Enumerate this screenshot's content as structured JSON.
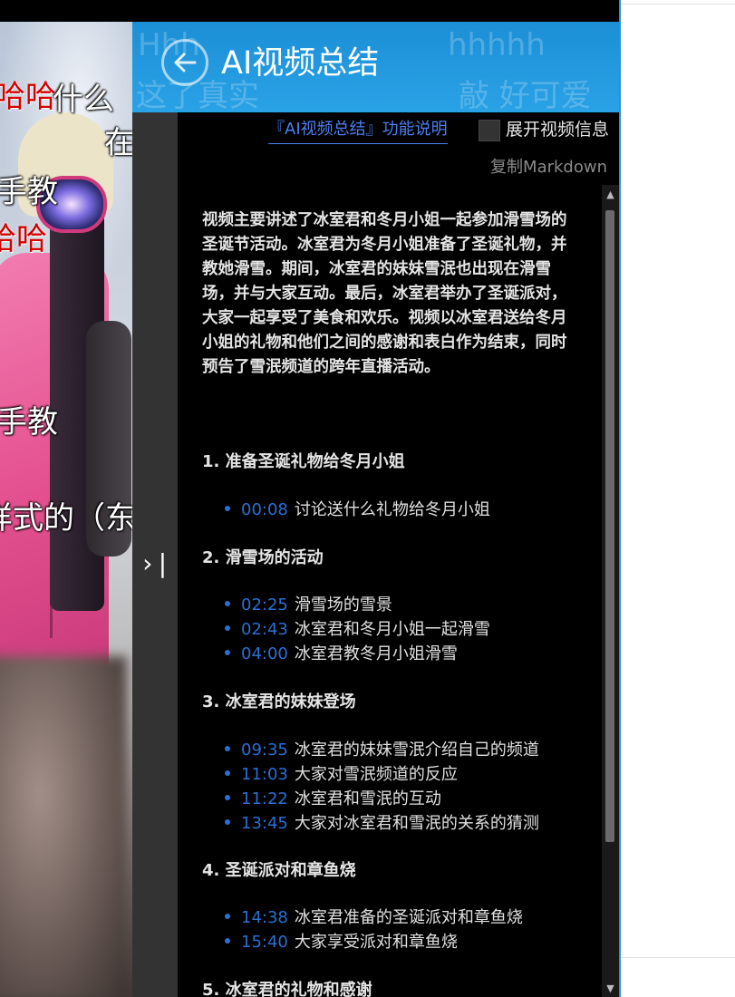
{
  "video": {
    "danmaku": [
      {
        "text": "哈哈",
        "color": "red"
      },
      {
        "text": "什么",
        "color": "white"
      },
      {
        "text": "在",
        "color": "white"
      },
      {
        "text": "手教",
        "color": "white"
      },
      {
        "text": "哈哈",
        "color": "red"
      },
      {
        "text": "手教",
        "color": "white"
      },
      {
        "text": "样式的（东",
        "color": "white"
      }
    ]
  },
  "header": {
    "title": "AI视频总结",
    "ghost_left_top": "Hhh",
    "ghost_left_bottom": "这了真实",
    "ghost_right_top": "hhhhh",
    "ghost_right_bottom": "敲 好可爱"
  },
  "toolbar": {
    "explain_link": "『AI视频总结』功能说明",
    "expand_label": "展开视频信息",
    "expand_checked": false,
    "copy_markdown": "复制Markdown"
  },
  "summary": "视频主要讲述了冰室君和冬月小姐一起参加滑雪场的圣诞节活动。冰室君为冬月小姐准备了圣诞礼物，并教她滑雪。期间，冰室君的妹妹雪泯也出现在滑雪场，并与大家互动。最后，冰室君举办了圣诞派对，大家一起享受了美食和欢乐。视频以冰室君送给冬月小姐的礼物和他们之间的感谢和表白作为结束，同时预告了雪泯频道的跨年直播活动。",
  "sections": [
    {
      "heading": "1. 准备圣诞礼物给冬月小姐",
      "items": [
        {
          "time": "00:08",
          "text": "讨论送什么礼物给冬月小姐"
        }
      ]
    },
    {
      "heading": "2. 滑雪场的活动",
      "items": [
        {
          "time": "02:25",
          "text": "滑雪场的雪景"
        },
        {
          "time": "02:43",
          "text": "冰室君和冬月小姐一起滑雪"
        },
        {
          "time": "04:00",
          "text": "冰室君教冬月小姐滑雪"
        }
      ]
    },
    {
      "heading": "3. 冰室君的妹妹登场",
      "items": [
        {
          "time": "09:35",
          "text": "冰室君的妹妹雪泯介绍自己的频道"
        },
        {
          "time": "11:03",
          "text": "大家对雪泯频道的反应"
        },
        {
          "time": "11:22",
          "text": "冰室君和雪泯的互动"
        },
        {
          "time": "13:45",
          "text": "大家对冰室君和雪泯的关系的猜测"
        }
      ]
    },
    {
      "heading": "4. 圣诞派对和章鱼烧",
      "items": [
        {
          "time": "14:38",
          "text": "冰室君准备的圣诞派对和章鱼烧"
        },
        {
          "time": "15:40",
          "text": "大家享受派对和章鱼烧"
        }
      ]
    },
    {
      "heading": "5. 冰室君的礼物和感谢",
      "items": []
    }
  ],
  "colors": {
    "header_bg": "#2499dc",
    "timestamp": "#2a6fd3",
    "link": "#4b7ff0",
    "panel_bg": "#000000",
    "rail_bg": "#333333"
  },
  "icons": {
    "back": "arrow-left-circle-icon",
    "collapse": "chevron-right-bar-icon",
    "scroll_up": "triangle-up-icon",
    "scroll_down": "triangle-down-icon"
  }
}
